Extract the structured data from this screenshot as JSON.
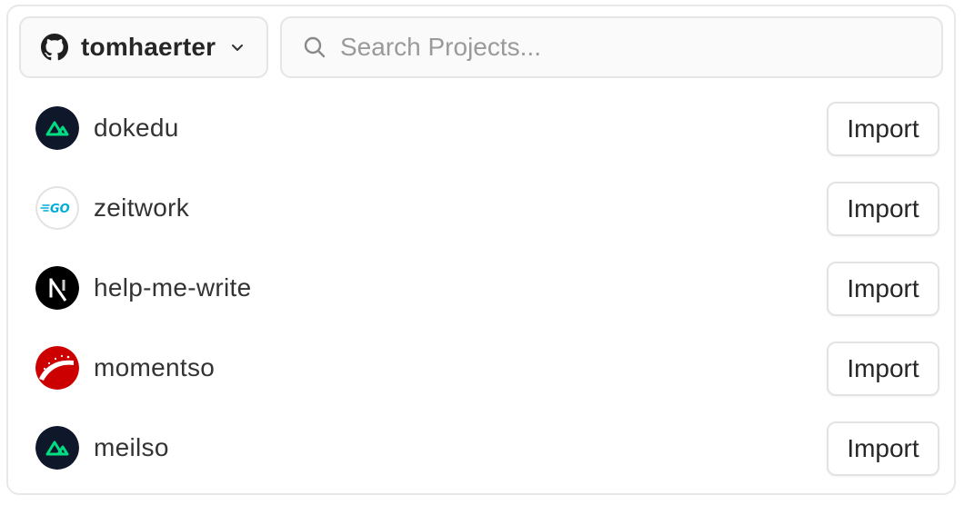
{
  "account": {
    "username": "tomhaerter",
    "icon": "github-icon"
  },
  "search": {
    "placeholder": "Search Projects...",
    "value": ""
  },
  "projects": [
    {
      "name": "dokedu",
      "logo": "nuxt-icon",
      "action": "Import"
    },
    {
      "name": "zeitwork",
      "logo": "go-icon",
      "action": "Import"
    },
    {
      "name": "help-me-write",
      "logo": "nextjs-icon",
      "action": "Import"
    },
    {
      "name": "momentso",
      "logo": "rails-icon",
      "action": "Import"
    },
    {
      "name": "meilso",
      "logo": "nuxt-icon",
      "action": "Import"
    }
  ],
  "colors": {
    "border": "#e5e5e5",
    "nuxt_bg": "#0f172a",
    "nuxt_green": "#00dc82",
    "go_blue": "#00add8",
    "rails_red": "#cc0000"
  }
}
